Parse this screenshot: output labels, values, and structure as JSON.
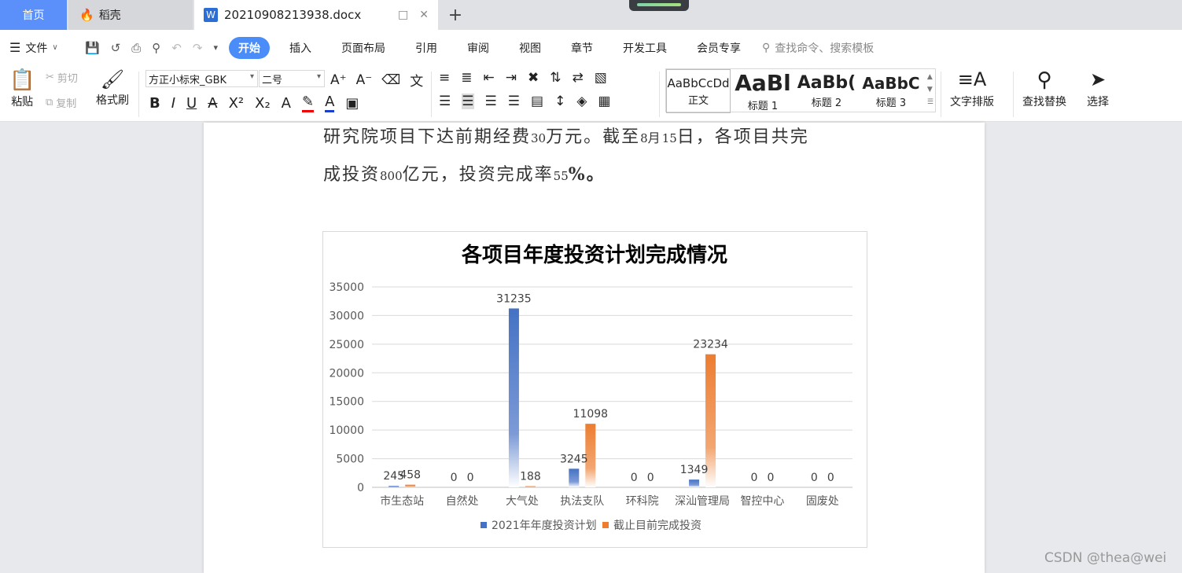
{
  "tabs": {
    "home": "首页",
    "daoke": "稻壳",
    "doc": "20210908213938.docx"
  },
  "menu": {
    "file": "文件",
    "items": [
      "开始",
      "插入",
      "页面布局",
      "引用",
      "审阅",
      "视图",
      "章节",
      "开发工具",
      "会员专享"
    ],
    "search_placeholder": "查找命令、搜索模板"
  },
  "ribbon": {
    "paste": "粘贴",
    "cut": "剪切",
    "copy": "复制",
    "format_painter": "格式刷",
    "font": "方正小标宋_GBK",
    "size": "二号",
    "styles": [
      {
        "preview": "AaBbCcDd",
        "name": "正文"
      },
      {
        "preview": "AaBl",
        "name": "标题 1"
      },
      {
        "preview": "AaBb(",
        "name": "标题 2"
      },
      {
        "preview": "AaBbC",
        "name": "标题 3"
      }
    ],
    "text_layout": "文字排版",
    "find_replace": "查找替换",
    "select": "选择"
  },
  "document": {
    "line1_a": "研究院项目下达前期经费",
    "line1_num": "30",
    "line1_b": "万元。截至",
    "line1_date1": "8",
    "line1_c": "月",
    "line1_date2": "15",
    "line1_d": "日，各项目共完",
    "line2_a": "成投资",
    "line2_num": "800",
    "line2_b": "亿元，投资完成率",
    "line2_pct": "55",
    "line2_c": "%。"
  },
  "chart_data": {
    "type": "bar",
    "title": "各项目年度投资计划完成情况",
    "categories": [
      "市生态站",
      "自然处",
      "大气处",
      "执法支队",
      "环科院",
      "深汕管理局",
      "智控中心",
      "固废处"
    ],
    "series": [
      {
        "name": "2021年年度投资计划",
        "values": [
          245,
          0,
          31235,
          3245,
          0,
          1349,
          0,
          0
        ],
        "color": "#4472c4"
      },
      {
        "name": "截止目前完成投资",
        "values": [
          458,
          0,
          188,
          11098,
          0,
          23234,
          0,
          0
        ],
        "color": "#ed7d31"
      }
    ],
    "ylim": [
      0,
      35000
    ],
    "yticks": [
      0,
      5000,
      10000,
      15000,
      20000,
      25000,
      30000,
      35000
    ],
    "grid": true,
    "legend": "bottom"
  },
  "watermark": "CSDN @thea@wei"
}
